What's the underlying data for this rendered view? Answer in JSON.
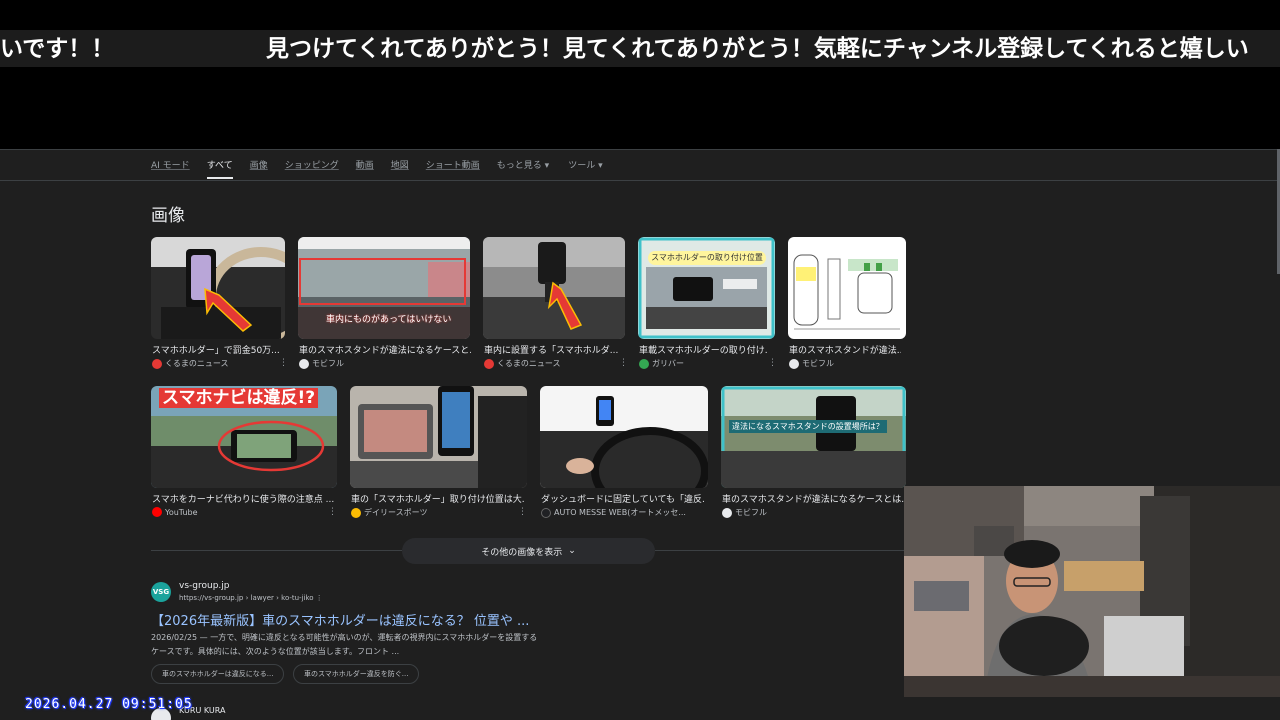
{
  "ticker": {
    "text_left": "いです！！",
    "text_right": "見つけてくれてありがとう！見てくれてありがとう！気軽にチャンネル登録してくれると嬉しい"
  },
  "tabs": [
    {
      "label": "AI モード"
    },
    {
      "label": "すべて"
    },
    {
      "label": "画像"
    },
    {
      "label": "ショッピング"
    },
    {
      "label": "動画"
    },
    {
      "label": "地図"
    },
    {
      "label": "ショート動画"
    },
    {
      "label": "もっと見る"
    },
    {
      "label": "ツール"
    }
  ],
  "images_section": {
    "title": "画像",
    "row1": [
      {
        "caption": "スマホホルダー」で罰金50万...",
        "source": "くるまのニュース",
        "source_color": "#e53935"
      },
      {
        "caption": "車のスマホスタンドが違法になるケースと...",
        "source": "モビフル",
        "source_color": "#e8eaed"
      },
      {
        "caption": "車内に設置する「スマホホルダ...",
        "source": "くるまのニュース",
        "source_color": "#e53935"
      },
      {
        "caption": "車載スマホホルダーの取り付け...",
        "source": "ガリバー",
        "source_color": "#34a853"
      },
      {
        "caption": "車のスマホスタンドが違法...",
        "source": "モビフル",
        "source_color": "#e8eaed"
      }
    ],
    "row2": [
      {
        "caption": "スマホをカーナビ代わりに使う際の注意点 ...",
        "source": "YouTube",
        "source_color": "#ff0000"
      },
      {
        "caption": "車の「スマホホルダー」取り付け位置は大...",
        "source": "デイリースポーツ",
        "source_color": "#fbbc04"
      },
      {
        "caption": "ダッシュボードに固定していても「違反...",
        "source": "AUTO MESSE WEB(オートメッセ...",
        "source_color": "#202124"
      },
      {
        "caption": "車のスマホスタンドが違法になるケースとは...",
        "source": "モビフル",
        "source_color": "#e8eaed"
      }
    ],
    "thumb_texts": {
      "t2_overlay": "車内にものがあってはいけない",
      "t4_banner": "スマホホルダーの取り付け位置",
      "t6_banner": "スマホナビは違反!?",
      "t9_banner": "違法になるスマホスタンドの設置場所は？"
    },
    "more_button": "その他の画像を表示"
  },
  "result1": {
    "favicon_text": "VSG",
    "site": "vs-group.jp",
    "url": "https://vs-group.jp › lawyer › ko-tu-jiko",
    "title": "【2026年最新版】車のスマホホルダーは違反になる？ 位置や ...",
    "snippet_date": "2026/02/25",
    "snippet_line1": " — 一方で、明確に違反となる可能性が高いのが、運転者の視界内にスマホホルダーを設置する",
    "snippet_line2": "ケースです。具体的には、次のような位置が該当します。フロント ...",
    "chips": [
      "車のスマホホルダーは違反になる...",
      "車のスマホホルダー違反を防ぐ..."
    ]
  },
  "result2": {
    "site": "KURU KURA"
  },
  "timestamp": "2026.04.27 09:51:05"
}
